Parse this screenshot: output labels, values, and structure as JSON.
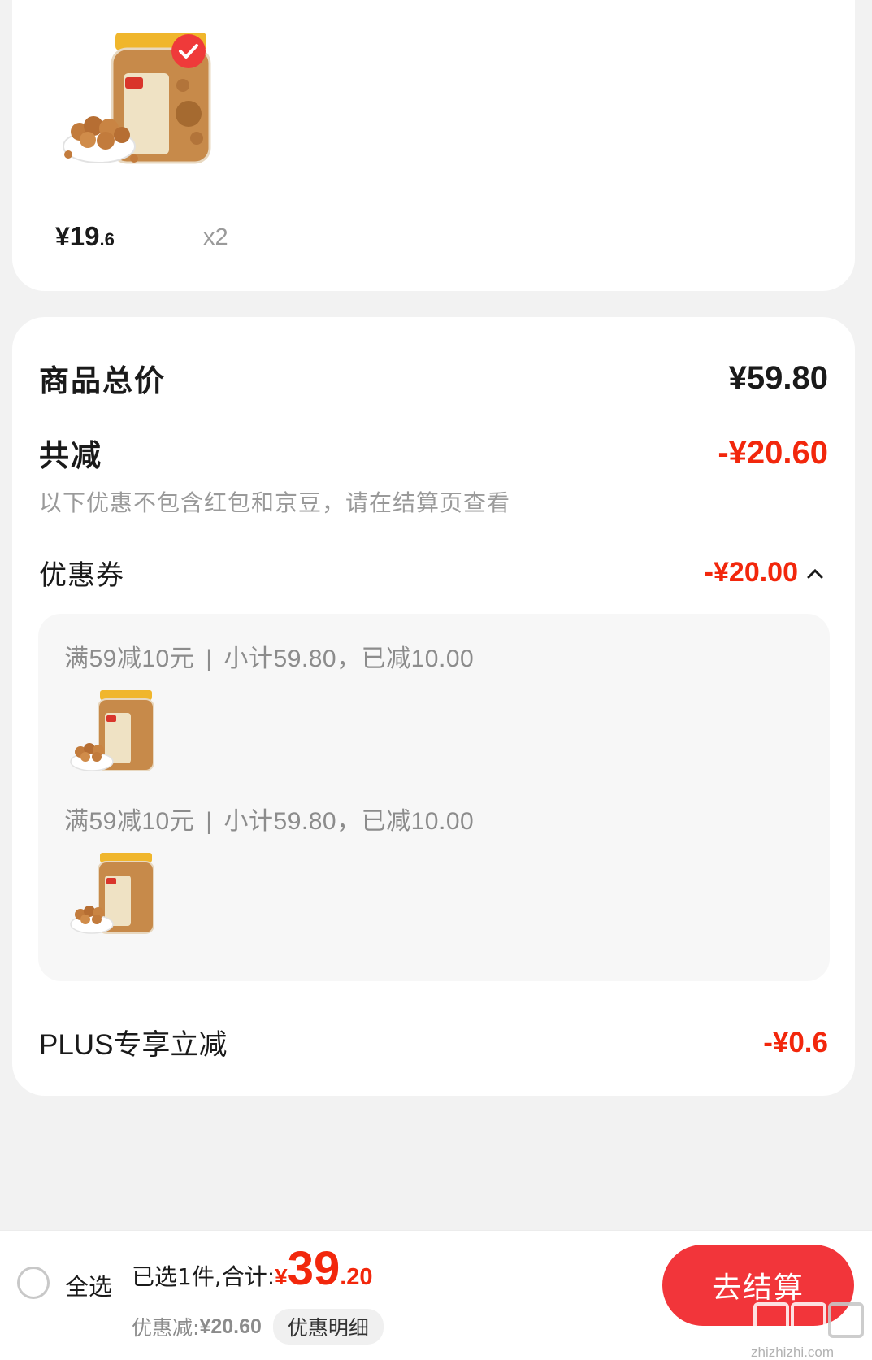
{
  "product": {
    "price_symbol": "¥",
    "price_int": "19",
    "price_dec": ".6",
    "quantity": "x2",
    "selected": true
  },
  "summary": {
    "total_label": "商品总价",
    "total_value": "¥59.80",
    "reduce_label": "共减",
    "reduce_value": "-¥20.60",
    "hint": "以下优惠不包含红包和京豆，请在结算页查看",
    "coupon_label": "优惠券",
    "coupon_value": "-¥20.00",
    "coupons": [
      {
        "rule": "满59减10元",
        "detail": "小计59.80，已减10.00"
      },
      {
        "rule": "满59减10元",
        "detail": "小计59.80，已减10.00"
      }
    ],
    "plus_label": "PLUS专享立减",
    "plus_value": "-¥0.6"
  },
  "bottom_bar": {
    "select_all": "全选",
    "selected_text": "已选1件,合计:",
    "total_symbol": "¥",
    "total_int": "39",
    "total_dec": ".20",
    "discount_text": "优惠减:",
    "discount_value": "¥20.60",
    "detail_button": "优惠明细",
    "checkout_button": "去结算",
    "watermark": "zhizhizhi.com"
  },
  "colors": {
    "accent_red": "#f2270c",
    "checkout_red": "#f2353a",
    "background": "#f2f2f2"
  }
}
